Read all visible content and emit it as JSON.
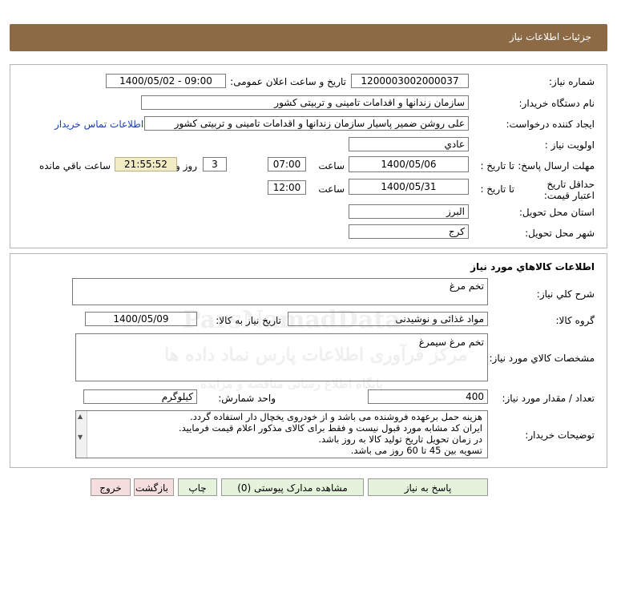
{
  "header": {
    "title": "جزئیات اطلاعات نیاز"
  },
  "need": {
    "number_label": "شماره نیاز:",
    "number": "1200003002000037",
    "announce_label": "تاریخ و ساعت اعلان عمومی:",
    "announce": "1400/05/02 - 09:00",
    "buyer_label": "نام دستگاه خریدار:",
    "buyer": "سازمان زندانها و اقدامات تامینی و تربیتی کشور",
    "creator_label": "ایجاد کننده درخواست:",
    "creator": "علی روشن ضمیر پاسیار سازمان زندانها و اقدامات تامینی و تربیتی کشور",
    "contact_link": "اطلاعات تماس خریدار",
    "priority_label": "اولویت نیاز :",
    "priority": "عادي",
    "deadline_label": "مهلت ارسال پاسخ:",
    "to_date_label": "تا تاریخ :",
    "deadline_date": "1400/05/06",
    "time_label": "ساعت",
    "deadline_time": "07:00",
    "days": "3",
    "days_label": "روز و",
    "remaining": "21:55:52",
    "remaining_label": "ساعت باقي مانده",
    "validity_label": "حداقل تاریخ اعتبار قیمت:",
    "validity_to_label": "تا تاریخ :",
    "validity_date": "1400/05/31",
    "validity_time_label": "ساعت",
    "validity_time": "12:00",
    "province_label": "استان محل تحویل:",
    "province": "البرز",
    "city_label": "شهر محل تحویل:",
    "city": "کرج"
  },
  "goods": {
    "section_title": "اطلاعات كالاهاي مورد نياز",
    "desc_label": "شرح كلي نياز:",
    "desc": "تخم مرغ",
    "group_label": "گروه كالا:",
    "group": "مواد غذائی و نوشیدنی",
    "need_date_label": "تاریخ نیاز به کالا:",
    "need_date": "1400/05/09",
    "spec_label": "مشخصات كالاي مورد نياز:",
    "spec": "تخم مرغ سیمرغ",
    "qty_label": "تعداد / مقدار مورد نیاز:",
    "qty": "400",
    "unit_label": "واحد شمارش:",
    "unit": "کیلوگرم",
    "notes_label": "توضيحات خريدار:",
    "notes": [
      "هزینه حمل برعهده فروشنده می باشد و از خودروی یخچال دار استفاده گردد.",
      "ایران کد مشابه مورد قبول نیست و فقط برای کالای مذکور اعلام قیمت فرمایید.",
      "در زمان تحویل تاریخ تولید کالا به روز باشد.",
      "تسویه بین 45 تا 60 روز می باشد."
    ]
  },
  "buttons": {
    "reply": "پاسخ به نیاز",
    "docs": "مشاهده مدارک پیوستی (0)",
    "print": "چاپ",
    "back": "بازگشت",
    "exit": "خروج"
  },
  "colors": {
    "header_bg": "#8c6a46",
    "reply_bg": "#e6f3dc",
    "docs_bg": "#e6f3dc",
    "print_bg": "#e6f3dc",
    "back_bg": "#f6dede",
    "exit_bg": "#f6dede",
    "remaining_bg": "#f2ecc4",
    "link": "#1a3fb5"
  },
  "watermark": {
    "brand": "ParsNamadData",
    "line1": "مرکز فرآوری اطلاعات پارس نماد داده ها",
    "line2": "پایگاه اطلاع رسانی مناقصه و مزایده"
  }
}
